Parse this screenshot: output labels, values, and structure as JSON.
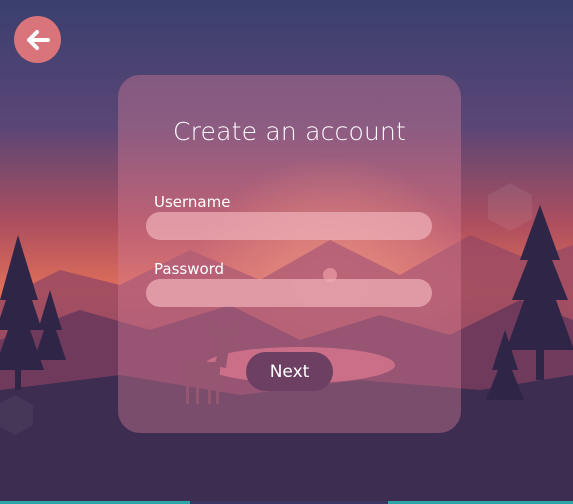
{
  "form": {
    "title": "Create an account",
    "username_label": "Username",
    "username_value": "",
    "password_label": "Password",
    "password_value": "",
    "next_label": "Next"
  },
  "icons": {
    "back": "arrow-left-icon"
  },
  "colors": {
    "back_button": "#d8747a",
    "next_button": "#6c3f63",
    "card": "#d67c96"
  }
}
